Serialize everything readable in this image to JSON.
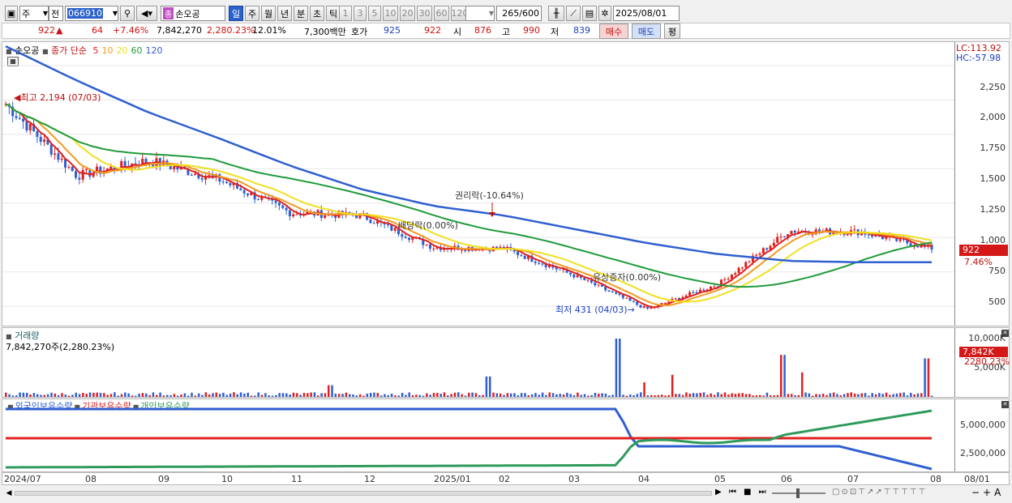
{
  "toolbar": {
    "market": "주",
    "scope": "전",
    "code": "066910",
    "stock_name": "손오공",
    "periods": [
      "일",
      "주",
      "월",
      "년",
      "분",
      "초",
      "틱"
    ],
    "active_period": "일",
    "intervals": [
      "1",
      "3",
      "5",
      "10",
      "20",
      "30",
      "60",
      "120"
    ],
    "count": "265",
    "count_max": "/600",
    "date": "2025/08/01"
  },
  "quote": {
    "price": "922",
    "arrow": "▲",
    "change": "64",
    "change_pct": "+7.46%",
    "volume": "7,842,270",
    "volume_pct": "2,280.23%",
    "turnover": "12.01%",
    "amount": "7,300백만",
    "hoga_label": "호가",
    "ask": "925",
    "bid": "922",
    "open_label": "시",
    "open": "876",
    "high_label": "고",
    "high": "990",
    "low_label": "저",
    "low": "839",
    "buy_label": "매수",
    "sell_label": "매도",
    "avg_label": "평"
  },
  "price_pane": {
    "title": "손오공",
    "legend_prefix": "종가 단순",
    "ma": [
      {
        "label": "5",
        "color": "#e02020"
      },
      {
        "label": "10",
        "color": "#f39a1e"
      },
      {
        "label": "20",
        "color": "#f0e020"
      },
      {
        "label": "60",
        "color": "#1f9a3a"
      },
      {
        "label": "120",
        "color": "#2f5fd0"
      }
    ],
    "lc": "LC:113.92",
    "hc": "HC:-57.98",
    "last_price": "922",
    "last_pct": "7.46%",
    "y_ticks": [
      "2,250",
      "2,000",
      "1,750",
      "1,500",
      "1,250",
      "1,000",
      "750",
      "500"
    ],
    "high_note": "최고 2,194 (07/03)",
    "low_note": "최저 431 (04/03)",
    "event_rights": "권리락(-10.64%)",
    "event_dividend": "배당락(0.00%)",
    "event_capital": "유상증자(0.00%)"
  },
  "volume_pane": {
    "title": "거래량",
    "value_text": "7,842,270주(2,280.23%)",
    "y_ticks": [
      "10,000K",
      "5,000K"
    ],
    "last_value": "7,842K",
    "last_pct": "2280.23%"
  },
  "holding_pane": {
    "legends": [
      "외국인보유수량",
      "기관보유수량",
      "개인보유수량"
    ],
    "colors": [
      "#2f5fd0",
      "#e02020",
      "#2f9a5a"
    ],
    "y_ticks": [
      "5,000,000",
      "2,500,000"
    ]
  },
  "x_axis": [
    "2024/07",
    "08",
    "09",
    "10",
    "11",
    "12",
    "2025/01",
    "02",
    "03",
    "04",
    "05",
    "06",
    "07",
    "08"
  ],
  "x_axis_right": "08/01",
  "chart_data": {
    "type": "line",
    "x": [
      "2024/07",
      "2024/08",
      "2024/09",
      "2024/10",
      "2024/11",
      "2024/12",
      "2025/01",
      "2025/02",
      "2025/03",
      "2025/04",
      "2025/05",
      "2025/06",
      "2025/07",
      "2025/08"
    ],
    "series": [
      {
        "name": "종가",
        "values": [
          1970,
          1450,
          1560,
          1420,
          1180,
          1160,
          930,
          920,
          720,
          480,
          660,
          1050,
          1040,
          922
        ]
      },
      {
        "name": "120",
        "values": [
          2390,
          2140,
          1910,
          1720,
          1520,
          1350,
          1230,
          1160,
          1060,
          960,
          880,
          830,
          820,
          820
        ]
      }
    ],
    "ylim": [
      360,
      2420
    ]
  }
}
